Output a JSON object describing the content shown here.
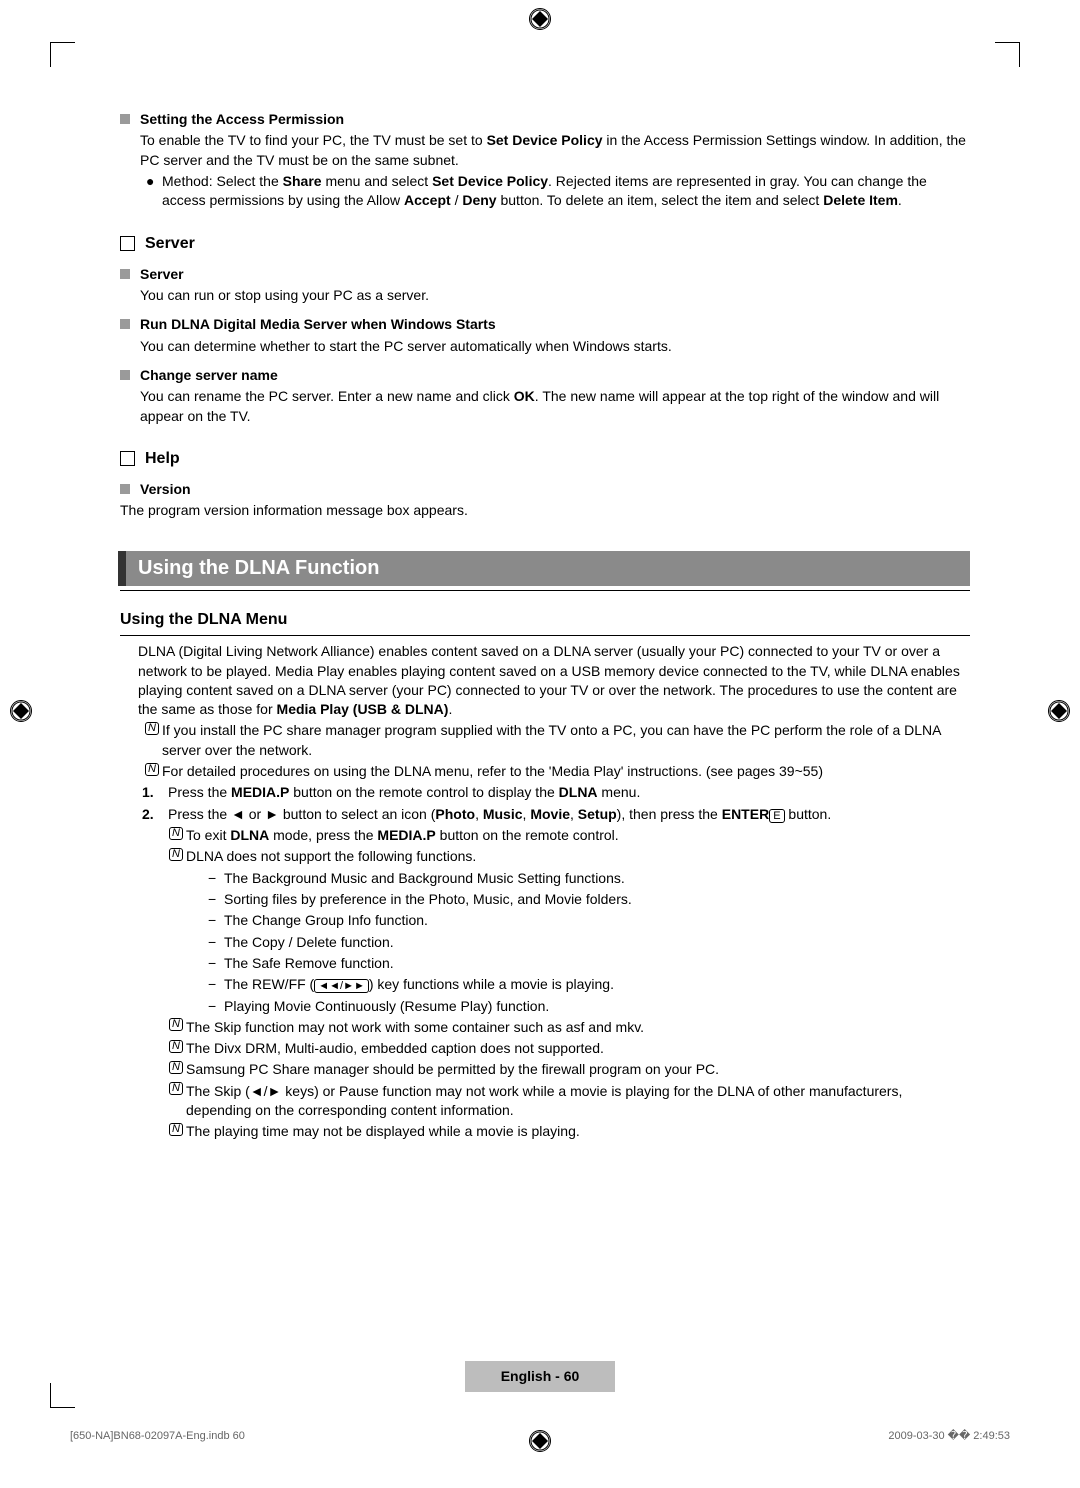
{
  "access": {
    "title": "Setting the Access Permission",
    "p1a": "To enable the TV to find your PC, the TV must be set to ",
    "p1b": "Set Device Policy",
    "p1c": " in the Access Permission Settings window. In addition, the PC server and the TV must be on the same subnet.",
    "m1a": "Method: Select the ",
    "m1b": "Share",
    "m1c": " menu and select ",
    "m1d": "Set Device Policy",
    "m1e": ". Rejected items are represented in gray. You can change the access permissions by using the Allow ",
    "m1f": "Accept",
    "m1g": " / ",
    "m1h": "Deny",
    "m1i": " button. To delete an item, select the item and select ",
    "m1j": "Delete Item",
    "m1k": "."
  },
  "server": {
    "heading": "Server",
    "s1_title": "Server",
    "s1_text": "You can run or stop using your PC as a server.",
    "s2_title": "Run DLNA Digital Media Server when Windows Starts",
    "s2_text": "You can determine whether to start the PC server automatically when Windows starts.",
    "s3_title": "Change server name",
    "s3_text_a": "You can rename the PC server. Enter a new name and click ",
    "s3_text_b": "OK",
    "s3_text_c": ". The new name will appear at the top right of the window and will appear on the TV."
  },
  "help": {
    "heading": "Help",
    "v_title": "Version",
    "v_text": "The program version information message box appears."
  },
  "dlna": {
    "bar": "Using the DLNA Function",
    "menu_h": "Using the DLNA Menu",
    "intro_a": "DLNA (Digital Living Network Alliance) enables content saved on a DLNA server (usually your PC) connected to your TV or over a network to be played. Media Play enables playing content saved on a USB memory device connected to the TV, while DLNA enables playing content saved on a DLNA server (your PC) connected to your TV or over the network. The procedures to use the content are the same as those for ",
    "intro_b": "Media Play (USB & DLNA)",
    "intro_c": ".",
    "n1": "If you install the PC share manager program supplied with the TV onto a PC, you can have the PC perform the role of a DLNA server over the network.",
    "n2": "For detailed procedures on using the DLNA menu, refer to the 'Media Play' instructions. (see pages 39~55)",
    "step1_a": "Press the ",
    "step1_b": "MEDIA.P",
    "step1_c": " button on the remote control to display the ",
    "step1_d": "DLNA",
    "step1_e": " menu.",
    "step2_a": "Press the ◄ or ► button to select an icon (",
    "step2_b": "Photo",
    "step2_c": ", ",
    "step2_d": "Music",
    "step2_e": ", ",
    "step2_f": "Movie",
    "step2_g": ", ",
    "step2_h": "Setup",
    "step2_i": "), then press the ",
    "step2_j": "ENTER",
    "step2_k": " button.",
    "s2n1_a": "To exit ",
    "s2n1_b": "DLNA",
    "s2n1_c": " mode, press the ",
    "s2n1_d": "MEDIA.P",
    "s2n1_e": " button on the remote control.",
    "s2n2": "DLNA does not support the following functions.",
    "d1": "The Background Music and Background Music Setting functions.",
    "d2": "Sorting files by preference in the Photo, Music, and Movie folders.",
    "d3": "The Change Group Info function.",
    "d4": "The Copy / Delete function.",
    "d5": "The Safe Remove function.",
    "d6_a": "The REW/FF (",
    "d6_b": ") key functions while a movie is playing.",
    "d7": "Playing Movie Continuously (Resume Play) function.",
    "n3": "The Skip function may not work with some container such as asf and mkv.",
    "n4": "The Divx DRM, Multi-audio, embedded caption does not supported.",
    "n5": "Samsung PC Share manager should be permitted by the firewall program on your PC.",
    "n6": "The Skip (◄/► keys) or Pause function may not work while a movie is playing for the DLNA of other manufacturers, depending on the corresponding content information.",
    "n7": "The playing time may not be displayed while a movie is playing."
  },
  "footer": {
    "page": "English - 60",
    "file": "[650-NA]BN68-02097A-Eng.indb   60",
    "time": "2009-03-30   �� 2:49:53"
  },
  "glyph": {
    "rewff": "◄◄/►►",
    "enter": "E"
  }
}
